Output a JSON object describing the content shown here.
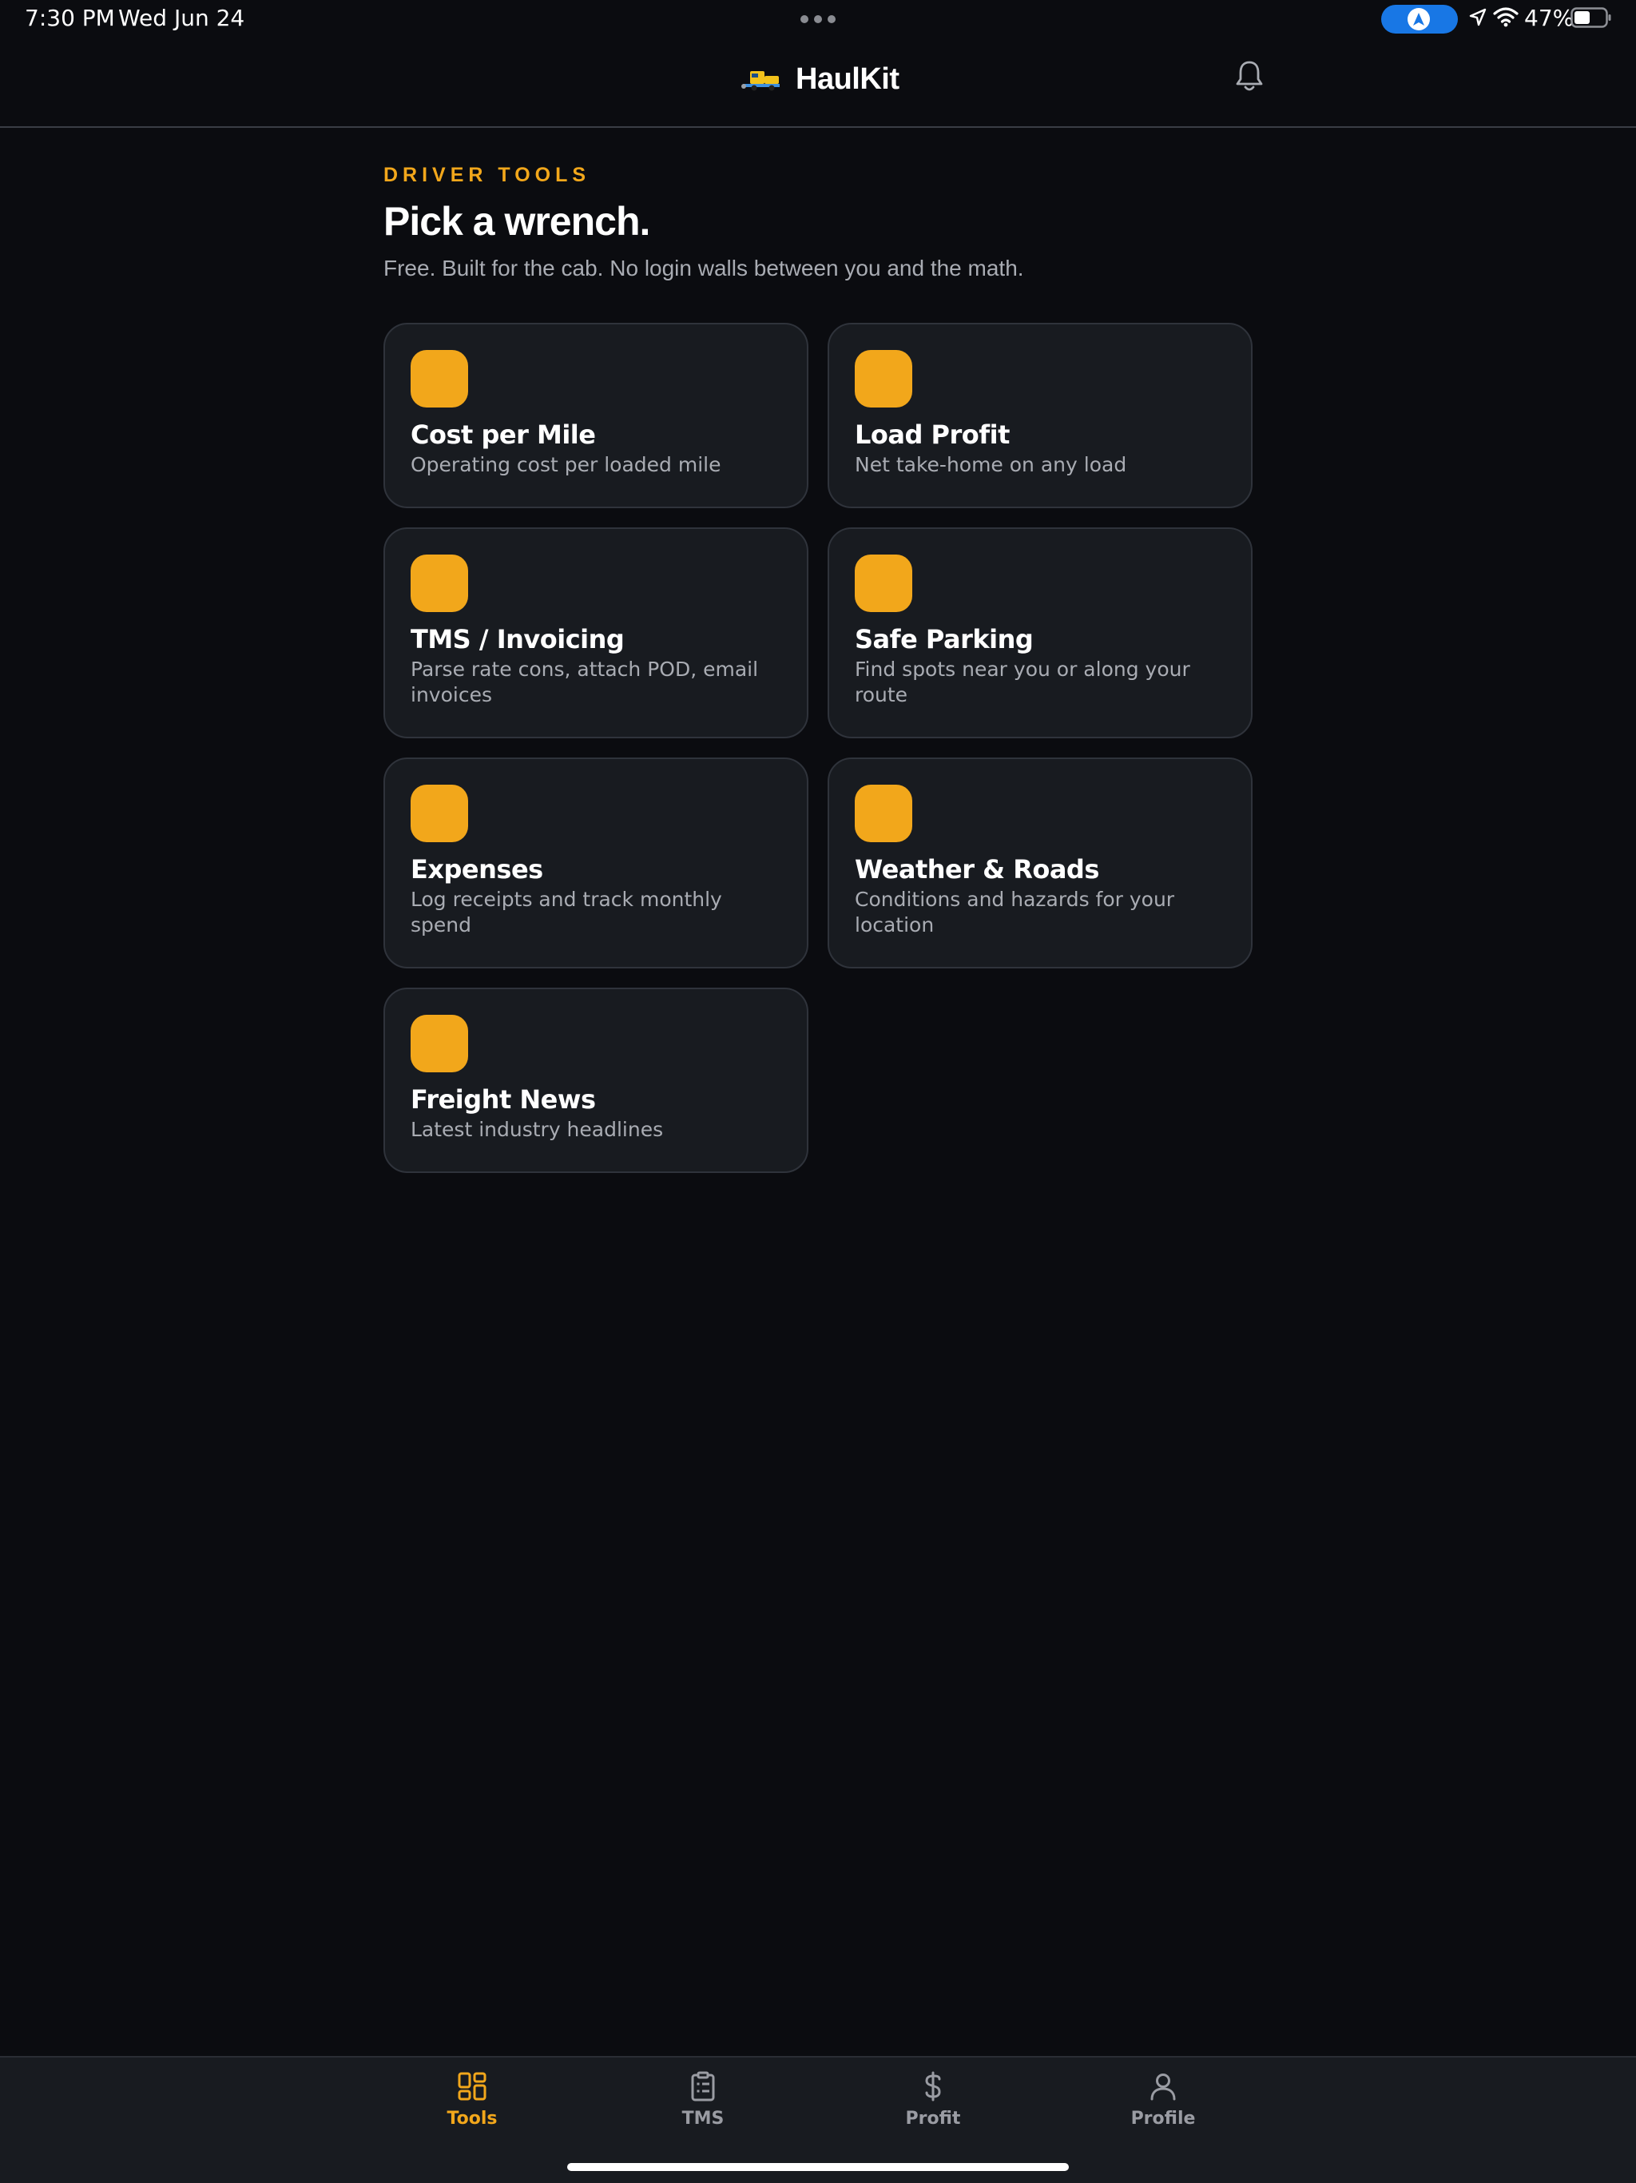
{
  "status_bar": {
    "time": "7:30 PM",
    "date": "Wed Jun 24",
    "battery": "47%"
  },
  "header": {
    "title": "HaulKit",
    "logo_icon": "truck-icon",
    "notification_icon": "bell-icon"
  },
  "page": {
    "eyebrow": "DRIVER TOOLS",
    "title": "Pick a wrench.",
    "subtitle": "Free. Built for the cab. No login walls between you and the math."
  },
  "tools": [
    {
      "title": "Cost per Mile",
      "description": "Operating cost per loaded mile"
    },
    {
      "title": "Load Profit",
      "description": "Net take-home on any load"
    },
    {
      "title": "TMS / Invoicing",
      "description": "Parse rate cons, attach POD, email invoices"
    },
    {
      "title": "Safe Parking",
      "description": "Find spots near you or along your route"
    },
    {
      "title": "Expenses",
      "description": "Log receipts and track monthly spend"
    },
    {
      "title": "Weather & Roads",
      "description": "Conditions and hazards for your location"
    },
    {
      "title": "Freight News",
      "description": "Latest industry headlines"
    }
  ],
  "tabs": [
    {
      "label": "Tools",
      "icon": "grid-icon",
      "active": true
    },
    {
      "label": "TMS",
      "icon": "clipboard-icon",
      "active": false
    },
    {
      "label": "Profit",
      "icon": "dollar-icon",
      "active": false
    },
    {
      "label": "Profile",
      "icon": "user-icon",
      "active": false
    }
  ],
  "colors": {
    "background": "#0b0c10",
    "card": "#181b20",
    "accent": "#f2a71b",
    "muted_text": "#a9acb3",
    "system_blue": "#1877e5"
  }
}
